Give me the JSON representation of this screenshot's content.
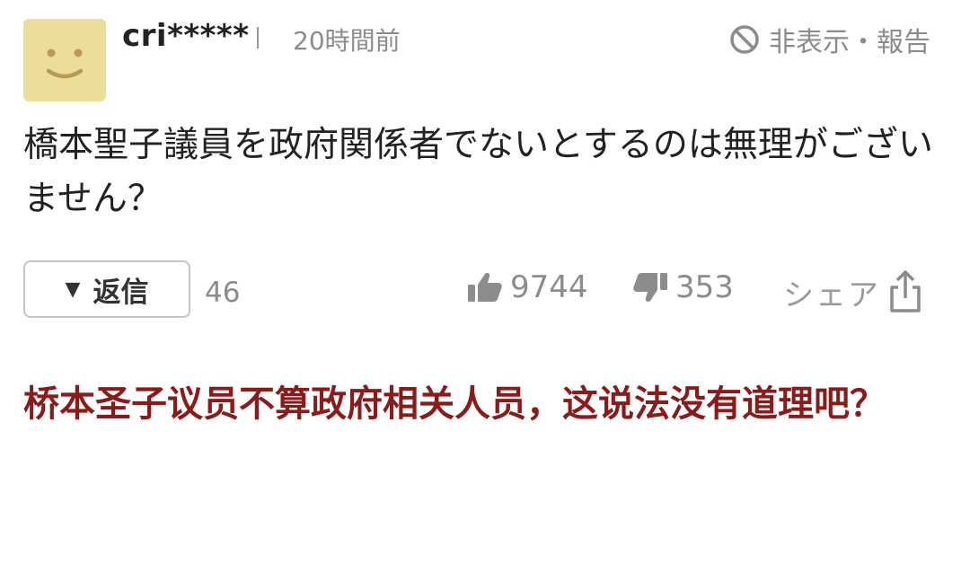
{
  "comment": {
    "username": "cri*****",
    "time_ago": "20時間前",
    "hide_report_label": "非表示・報告",
    "body": "橋本聖子議員を政府関係者でないとするのは無理がございません？",
    "reply_label": "返信",
    "reply_count": "46",
    "likes": "9744",
    "dislikes": "353",
    "share_label": "シェア"
  },
  "translation": "桥本圣子议员不算政府相关人员，这说法没有道理吧？",
  "colors": {
    "avatar_bg": "#ebdd9a",
    "avatar_face": "#b99a55",
    "muted": "#8c8c8c",
    "translation_text": "#8b1b1b"
  },
  "icons": {
    "avatar": "smiley-face-icon",
    "hide": "prohibited-icon",
    "reply_toggle": "triangle-down-icon",
    "like": "thumbs-up-icon",
    "dislike": "thumbs-down-icon",
    "share": "share-upload-icon"
  }
}
